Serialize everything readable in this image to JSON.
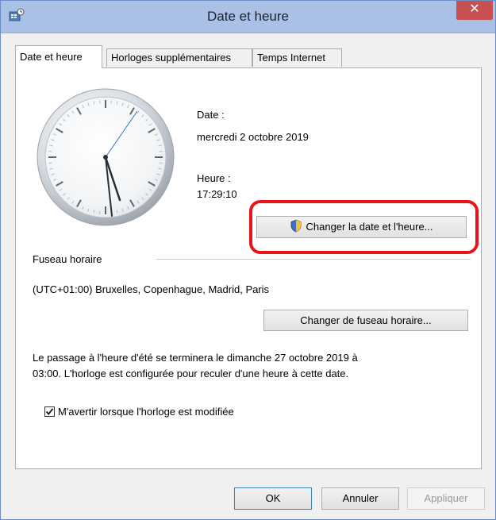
{
  "window": {
    "title": "Date et heure",
    "close_glyph": "✕",
    "accent_color": "#a9c1e6",
    "close_color": "#c75050"
  },
  "tabs": [
    {
      "label": "Date et heure",
      "active": true
    },
    {
      "label": "Horloges supplémentaires",
      "active": false
    },
    {
      "label": "Temps Internet",
      "active": false
    }
  ],
  "date": {
    "label": "Date :",
    "value": "mercredi 2 octobre 2019"
  },
  "time": {
    "label": "Heure :",
    "value": "17:29:10"
  },
  "change_datetime_button": "Changer la date et l'heure...",
  "timezone": {
    "section_label": "Fuseau horaire",
    "value": "(UTC+01:00) Bruxelles, Copenhague, Madrid, Paris",
    "change_button": "Changer de fuseau horaire..."
  },
  "dst_notice": {
    "line1": "Le passage à l'heure d'été se terminera le dimanche 27 octobre 2019 à",
    "line2": "03:00. L'horloge est configurée pour reculer d'une heure à cette date."
  },
  "notify_checkbox": {
    "label": "M'avertir lorsque l'horloge est modifiée",
    "checked": true
  },
  "footer": {
    "ok": "OK",
    "cancel": "Annuler",
    "apply": "Appliquer"
  },
  "highlight_color": "#e8121b"
}
